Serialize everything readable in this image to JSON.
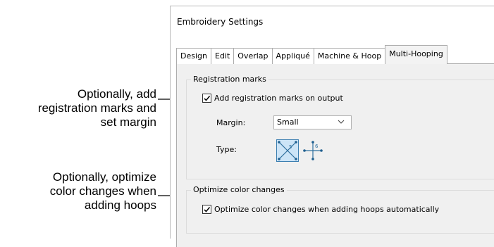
{
  "callouts": {
    "first": [
      "Optionally, add",
      "registration marks and",
      "set margin"
    ],
    "second": [
      "Optionally, optimize",
      "color changes when",
      "adding hoops"
    ]
  },
  "dialog": {
    "title": "Embroidery Settings",
    "tabs": [
      {
        "label": "Design",
        "active": false
      },
      {
        "label": "Edit",
        "active": false
      },
      {
        "label": "Overlap",
        "active": false
      },
      {
        "label": "Appliqué",
        "active": false
      },
      {
        "label": "Machine & Hoop",
        "active": false
      },
      {
        "label": "Multi-Hooping",
        "active": true
      }
    ],
    "registration": {
      "legend": "Registration marks",
      "add_marks_label": "Add registration marks on output",
      "add_marks_checked": true,
      "margin_label": "Margin:",
      "margin_value": "Small",
      "type_label": "Type:",
      "type_options": [
        {
          "icon": "cross-diagonal-mark-icon",
          "number": "5",
          "selected": true
        },
        {
          "icon": "cross-plus-mark-icon",
          "number": "6",
          "selected": false
        }
      ]
    },
    "optimize": {
      "legend": "Optimize color changes",
      "checkbox_label": "Optimize color changes when adding hoops automatically",
      "checked": true
    }
  },
  "colors": {
    "accent": "#1f7fb8",
    "panel": "#f0f0f0",
    "selected_fill": "#cce4f7"
  }
}
